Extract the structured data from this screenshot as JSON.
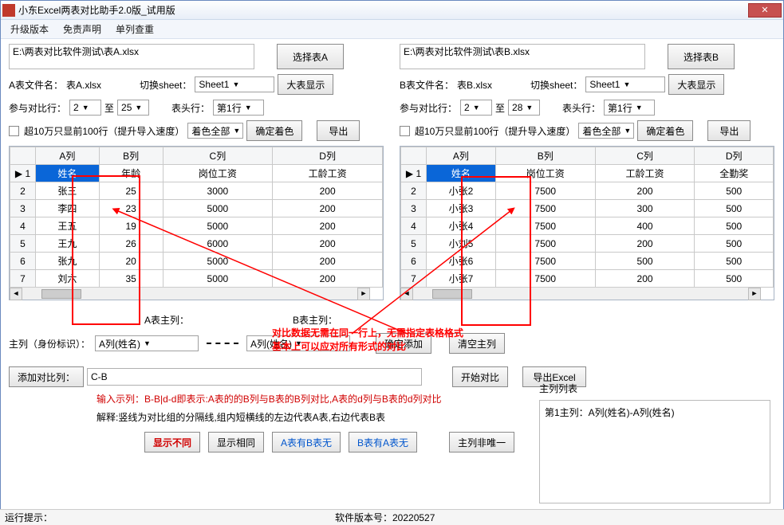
{
  "title": "小东Excel两表对比助手2.0版_试用版",
  "menu": {
    "upgrade": "升级版本",
    "disclaimer": "免责声明",
    "single": "单列查重"
  },
  "left": {
    "path": "E:\\两表对比软件测试\\表A.xlsx",
    "selectBtn": "选择表A",
    "fileLabel": "A表文件名：",
    "fileName": "表A.xlsx",
    "sheetLabel": "切换sheet：",
    "sheet": "Sheet1",
    "bigShow": "大表显示",
    "rowsLabel": "参与对比行：",
    "rowFrom": "2",
    "to": "至",
    "rowTo": "25",
    "headerLabel": "表头行：",
    "headerRow": "第1行",
    "limitLabel": "超10万只显前100行（提升导入速度）",
    "colorSel": "着色全部",
    "confirmColor": "确定着色",
    "export": "导出",
    "cols": [
      "",
      "A列",
      "B列",
      "C列",
      "D列"
    ],
    "headRow": [
      "1",
      "姓名",
      "年龄",
      "岗位工资",
      "工龄工资"
    ],
    "rows": [
      [
        "2",
        "张三",
        "25",
        "3000",
        "200"
      ],
      [
        "3",
        "李四",
        "23",
        "5000",
        "200"
      ],
      [
        "4",
        "王五",
        "19",
        "5000",
        "200"
      ],
      [
        "5",
        "王九",
        "26",
        "6000",
        "200"
      ],
      [
        "6",
        "张九",
        "20",
        "5000",
        "200"
      ],
      [
        "7",
        "刘六",
        "35",
        "5000",
        "200"
      ]
    ]
  },
  "right": {
    "path": "E:\\两表对比软件测试\\表B.xlsx",
    "selectBtn": "选择表B",
    "fileLabel": "B表文件名：",
    "fileName": "表B.xlsx",
    "sheetLabel": "切换sheet：",
    "sheet": "Sheet1",
    "bigShow": "大表显示",
    "rowsLabel": "参与对比行：",
    "rowFrom": "2",
    "to": "至",
    "rowTo": "28",
    "headerLabel": "表头行：",
    "headerRow": "第1行",
    "limitLabel": "超10万只显前100行（提升导入速度）",
    "colorSel": "着色全部",
    "confirmColor": "确定着色",
    "export": "导出",
    "cols": [
      "",
      "A列",
      "B列",
      "C列",
      "D列"
    ],
    "headRow": [
      "1",
      "姓名",
      "岗位工资",
      "工龄工资",
      "全勤奖"
    ],
    "rows": [
      [
        "2",
        "小张2",
        "7500",
        "200",
        "500"
      ],
      [
        "3",
        "小张3",
        "7500",
        "300",
        "500"
      ],
      [
        "4",
        "小张4",
        "7500",
        "400",
        "500"
      ],
      [
        "5",
        "小刘5",
        "7500",
        "200",
        "500"
      ],
      [
        "6",
        "小张6",
        "7500",
        "500",
        "500"
      ],
      [
        "7",
        "小张7",
        "7500",
        "200",
        "500"
      ]
    ]
  },
  "annot": {
    "line1": "对比数据无需在同一行上，无需指定表格格式",
    "line2": "基本上可以应对所有形式的对比"
  },
  "mid": {
    "aMainLabel": "A表主列：",
    "bMainLabel": "B表主列：",
    "mainColLabel": "主列（身份标识）：",
    "aMainSel": "A列(姓名)",
    "bMainSel": "A列(姓名)",
    "addConfirm": "确定添加",
    "clearMain": "清空主列",
    "listLabel": "主列列表",
    "listItem": "第1主列：A列(姓名)-A列(姓名)"
  },
  "bottom": {
    "addCompareLabel": "添加对比列：",
    "compareVal": "C-B",
    "startCompare": "开始对比",
    "exportExcel": "导出Excel",
    "hint": "输入示列：B-B|d-d即表示:A表的的B列与B表的B列对比,A表的d列与B表的d列对比",
    "explain": "解释:竖线为对比组的分隔线,组内短横线的左边代表A表,右边代表B表",
    "showDiff": "显示不同",
    "showSame": "显示相同",
    "aHasBNo": "A表有B表无",
    "bHasANo": "B表有A表无",
    "notUnique": "主列非唯一"
  },
  "status": {
    "tip": "运行提示：",
    "ver": "软件版本号：20220527"
  }
}
